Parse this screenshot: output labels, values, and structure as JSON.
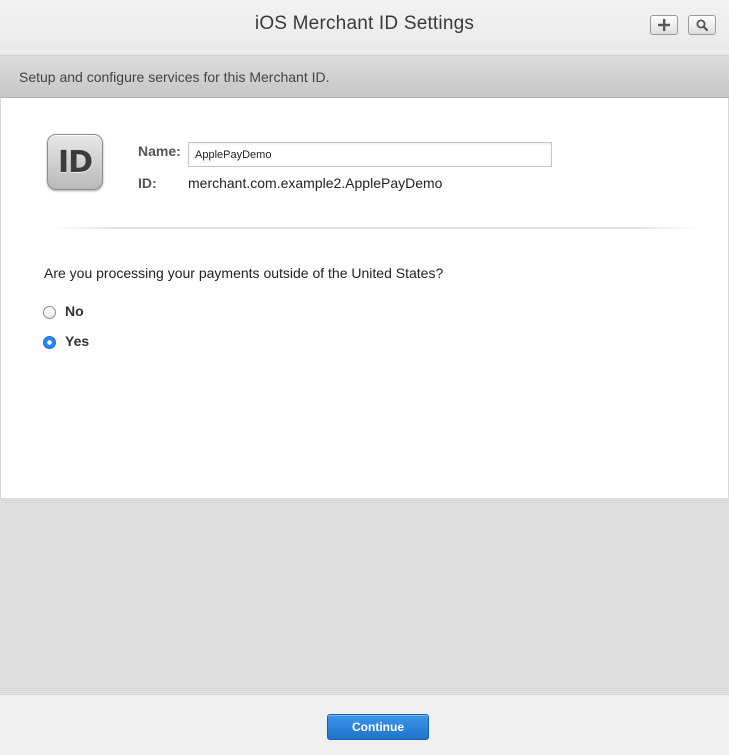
{
  "window": {
    "title": "iOS Merchant ID Settings"
  },
  "toolbar": {
    "add_icon": "plus-icon",
    "search_icon": "search-icon"
  },
  "subheader": {
    "text": "Setup and configure services for this Merchant ID."
  },
  "merchant": {
    "icon_text": "ID",
    "name_label": "Name:",
    "name_value": "ApplePayDemo",
    "id_label": "ID:",
    "id_value": "merchant.com.example2.ApplePayDemo"
  },
  "question": {
    "text": "Are you processing your payments outside of the United States?",
    "options": [
      {
        "label": "No",
        "selected": false
      },
      {
        "label": "Yes",
        "selected": true
      }
    ]
  },
  "footer": {
    "continue_label": "Continue"
  },
  "colors": {
    "accent": "#2a86ee",
    "button": "#1f74cc"
  }
}
